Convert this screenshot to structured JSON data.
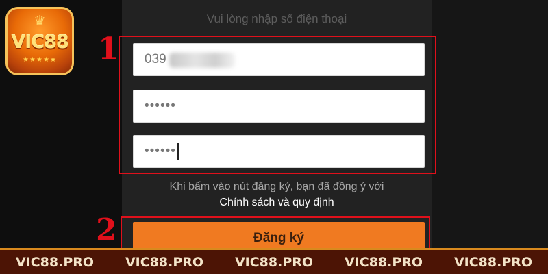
{
  "logo": {
    "brand": "VIC88",
    "crown_icon": "crown-icon",
    "stars": "★★★★★"
  },
  "form": {
    "phone_hint": "Vui lòng nhập số điện thoại",
    "phone_value_visible": "039",
    "password_mask": "••••••",
    "confirm_mask": "••••••",
    "terms_text": "Khi bấm vào nút đăng ký, bạn đã đồng ý với",
    "policy_link": "Chính sách và quy định",
    "register_label": "Đăng ký"
  },
  "annotations": {
    "step1": "1",
    "step2": "2",
    "highlight_color": "#e0101b"
  },
  "footer": {
    "items": [
      "VIC88.PRO",
      "VIC88.PRO",
      "VIC88.PRO",
      "VIC88.PRO",
      "VIC88.PRO"
    ]
  },
  "colors": {
    "accent": "#f07a21",
    "footer_bg": "#4c1405",
    "footer_border": "#d98a1e"
  }
}
